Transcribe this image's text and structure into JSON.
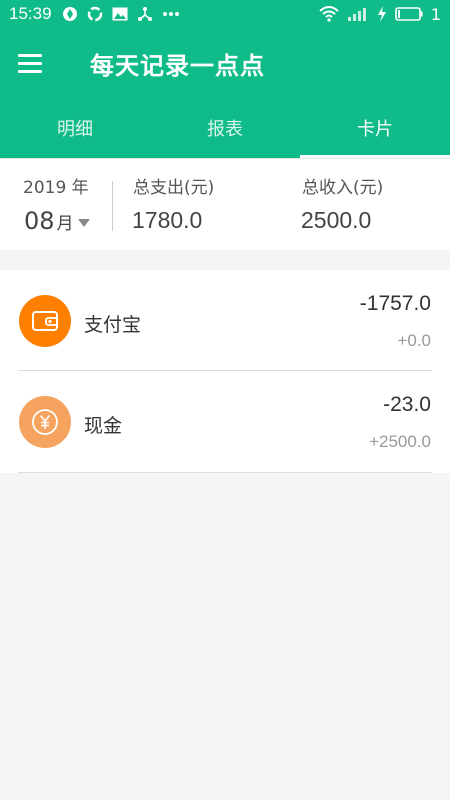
{
  "status_bar": {
    "time": "15:39",
    "icons_left": [
      "sync-icon",
      "refresh-icon",
      "image-notification-icon",
      "share-icon",
      "more-icon"
    ],
    "battery_level": "1"
  },
  "header": {
    "title": "每天记录一点点",
    "menu_icon": "hamburger-menu-icon"
  },
  "tabs": [
    {
      "label": "明细",
      "active": false
    },
    {
      "label": "报表",
      "active": false
    },
    {
      "label": "卡片",
      "active": true
    }
  ],
  "summary": {
    "year_label": "2019 年",
    "month_value": "08",
    "month_unit": "月",
    "expense_label": "总支出(元)",
    "expense_value": "1780.0",
    "income_label": "总收入(元)",
    "income_value": "2500.0"
  },
  "accounts": [
    {
      "name": "支付宝",
      "amount": "-1757.0",
      "income": "+0.0",
      "icon": "wallet-icon",
      "color": "#ff7f00"
    },
    {
      "name": "现金",
      "amount": "-23.0",
      "income": "+2500.0",
      "icon": "yuan-coin-icon",
      "color": "#f5a35e"
    }
  ],
  "colors": {
    "primary": "#10bb8a",
    "background": "#f5f5f5"
  }
}
